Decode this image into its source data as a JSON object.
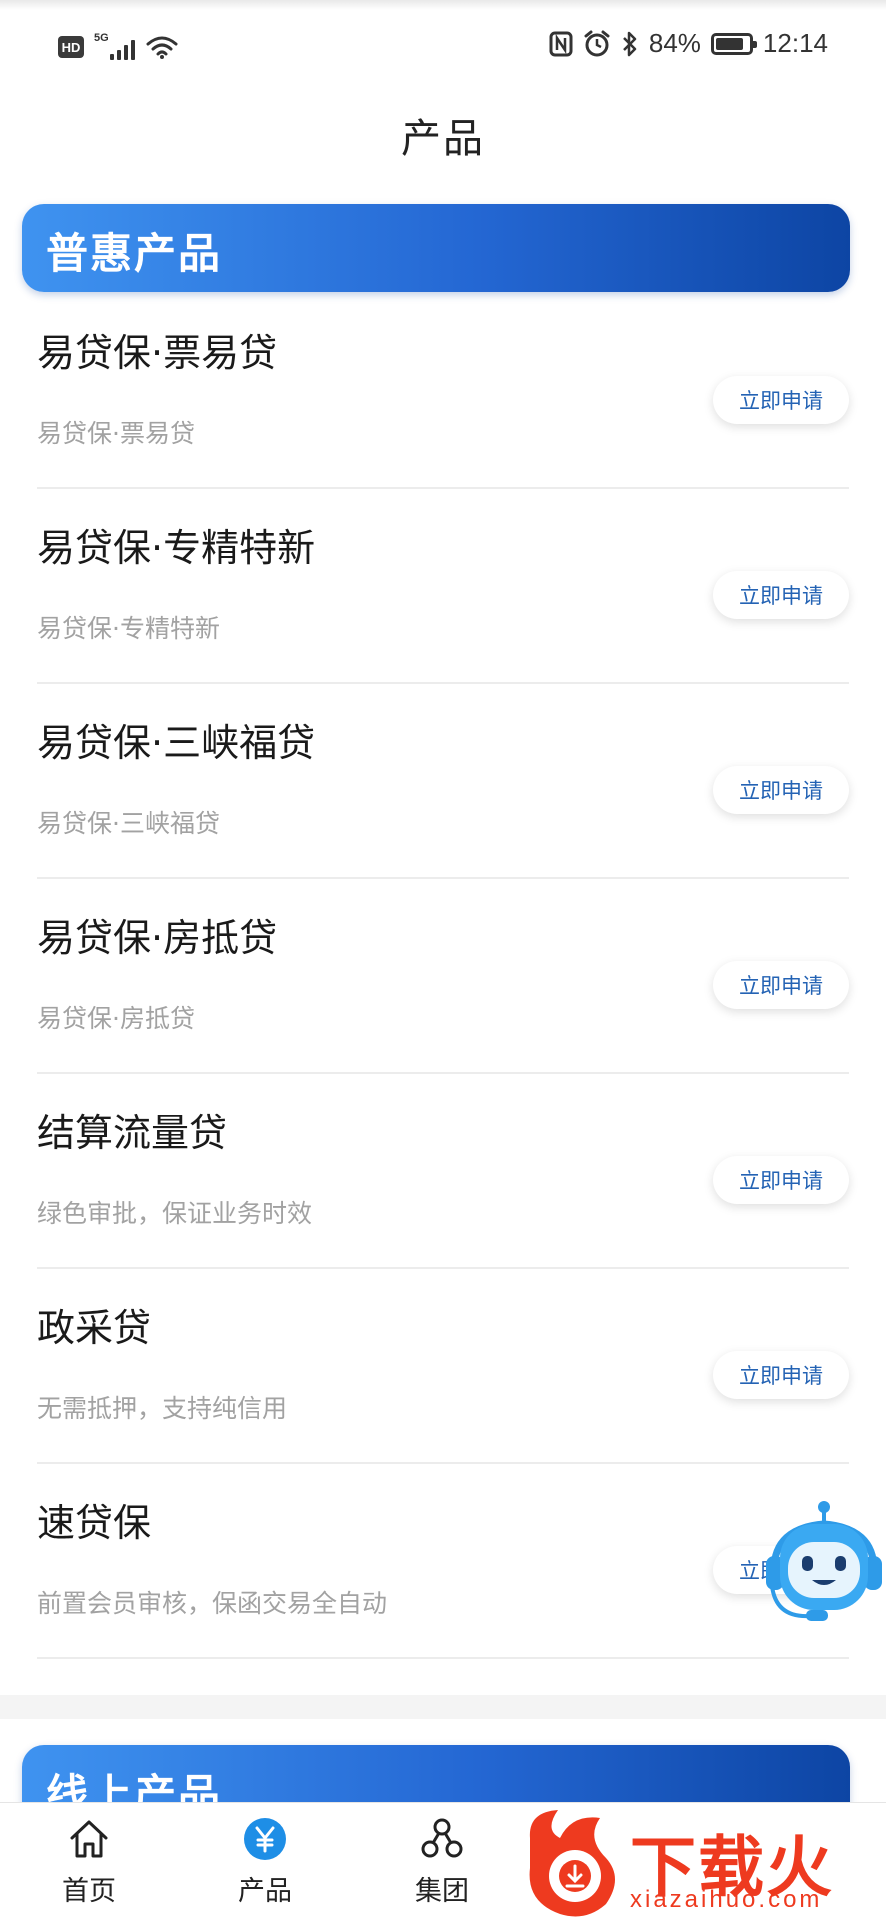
{
  "status_bar": {
    "hd_label": "HD",
    "network_label": "5G",
    "battery_percent": "84%",
    "battery_level": 0.84,
    "time": "12:14"
  },
  "page": {
    "title": "产品"
  },
  "sections": {
    "inclusive": {
      "title": "普惠产品"
    },
    "online": {
      "title": "线上产品"
    }
  },
  "products": [
    {
      "name": "易贷保·票易贷",
      "desc": "易贷保·票易贷",
      "button": "立即申请"
    },
    {
      "name": "易贷保·专精特新",
      "desc": "易贷保·专精特新",
      "button": "立即申请"
    },
    {
      "name": "易贷保·三峡福贷",
      "desc": "易贷保·三峡福贷",
      "button": "立即申请"
    },
    {
      "name": "易贷保·房抵贷",
      "desc": "易贷保·房抵贷",
      "button": "立即申请"
    },
    {
      "name": "结算流量贷",
      "desc": "绿色审批，保证业务时效",
      "button": "立即申请"
    },
    {
      "name": "政采贷",
      "desc": "无需抵押，支持纯信用",
      "button": "立即申请"
    },
    {
      "name": "速贷保",
      "desc": "前置会员审核，保函交易全自动",
      "button": "立即申请"
    }
  ],
  "assistant": {
    "icon": "robot-assistant-icon"
  },
  "bottom_nav": [
    {
      "label": "首页",
      "icon": "home-icon"
    },
    {
      "label": "产品",
      "icon": "yuan-icon"
    },
    {
      "label": "集团",
      "icon": "group-icon"
    }
  ],
  "watermark": {
    "main": "下载火",
    "sub": "xiazaihuo.com"
  },
  "colors": {
    "header_gradient_start": "#3f93f0",
    "header_gradient_end": "#0d45a4",
    "button_text": "#2463b4",
    "active_nav": "#1e8ee6",
    "watermark": "#ee3a1f"
  }
}
